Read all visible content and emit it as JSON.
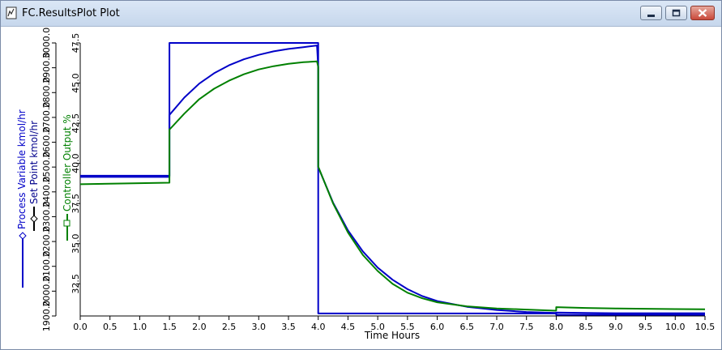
{
  "window": {
    "title": "FC.ResultsPlot Plot",
    "icons": {
      "app": "plot-icon",
      "minimize": "minimize-icon",
      "maximize": "maximize-icon",
      "close": "close-icon"
    }
  },
  "chart_data": {
    "type": "line",
    "xlabel": "Time Hours",
    "x_ticks": [
      "0.0",
      "0.5",
      "1.0",
      "1.5",
      "2.0",
      "2.5",
      "3.0",
      "3.5",
      "4.0",
      "4.5",
      "5.0",
      "5.5",
      "6.0",
      "6.5",
      "7.0",
      "7.5",
      "8.0",
      "8.5",
      "9.0",
      "9.5",
      "10.0",
      "10.5"
    ],
    "xlim": [
      0,
      10.5
    ],
    "grid": false,
    "y_axes": [
      {
        "label": "Process Variable kmol/hr",
        "label2": "Set Point kmol/hr",
        "ticks": [
          "1900.0",
          "2000.0",
          "2100.0",
          "2200.0",
          "2300.0",
          "2400.0",
          "2500.0",
          "2600.0",
          "2700.0",
          "2800.0",
          "2900.0",
          "3000.0"
        ],
        "ylim": [
          1900,
          3000
        ]
      },
      {
        "label": "Controller Output %",
        "ticks": [
          "32.5",
          "35.0",
          "37.5",
          "40.0",
          "42.5",
          "45.0",
          "47.5"
        ],
        "ylim": [
          30.5,
          47.5
        ]
      }
    ],
    "series": [
      {
        "name": "Process Variable kmol/hr",
        "axis": 0,
        "color": "#0000c8",
        "marker": "diamond",
        "x": [
          0,
          1.5,
          1.5,
          1.75,
          2.0,
          2.25,
          2.5,
          2.75,
          3.0,
          3.25,
          3.5,
          3.75,
          3.98,
          4.0,
          4.0,
          4.25,
          4.5,
          4.75,
          5.0,
          5.25,
          5.5,
          5.75,
          6.0,
          6.5,
          7.0,
          7.5,
          8.0,
          8.0,
          8.5,
          9.0,
          9.5,
          10.0,
          10.5
        ],
        "y": [
          2460,
          2460,
          2710,
          2780,
          2836,
          2878,
          2910,
          2934,
          2952,
          2966,
          2976,
          2983,
          2990,
          2900,
          2500,
          2356,
          2245,
          2160,
          2095,
          2046,
          2008,
          1980,
          1960,
          1937,
          1924,
          1916,
          1912,
          1914,
          1912,
          1911,
          1911,
          1911,
          1911
        ]
      },
      {
        "name": "Set Point kmol/hr",
        "axis": 0,
        "color": "#0000c8",
        "marker": "diamond",
        "x": [
          0,
          1.5,
          1.5,
          4.0,
          4.0,
          8.0,
          8.0,
          10.5
        ],
        "y": [
          2465,
          2465,
          3000,
          3000,
          1910,
          1910,
          1905,
          1905
        ]
      },
      {
        "name": "Controller Output %",
        "axis": 1,
        "color": "#008000",
        "marker": "square",
        "x": [
          0,
          1.5,
          1.5,
          1.75,
          2.0,
          2.25,
          2.5,
          2.75,
          3.0,
          3.25,
          3.5,
          3.75,
          3.98,
          4.0,
          4.0,
          4.25,
          4.5,
          4.75,
          5.0,
          5.25,
          5.5,
          5.75,
          6.0,
          6.5,
          7.0,
          7.5,
          7.99,
          8.0,
          8.0,
          8.5,
          9.0,
          9.5,
          10.0,
          10.5
        ],
        "y": [
          38.7,
          38.8,
          42.1,
          43.1,
          44.0,
          44.65,
          45.15,
          45.55,
          45.85,
          46.05,
          46.2,
          46.3,
          46.35,
          46.0,
          39.8,
          37.5,
          35.7,
          34.3,
          33.3,
          32.5,
          31.95,
          31.6,
          31.35,
          31.1,
          30.97,
          30.9,
          30.83,
          30.85,
          31.05,
          31.0,
          30.97,
          30.95,
          30.93,
          30.92
        ]
      }
    ]
  }
}
